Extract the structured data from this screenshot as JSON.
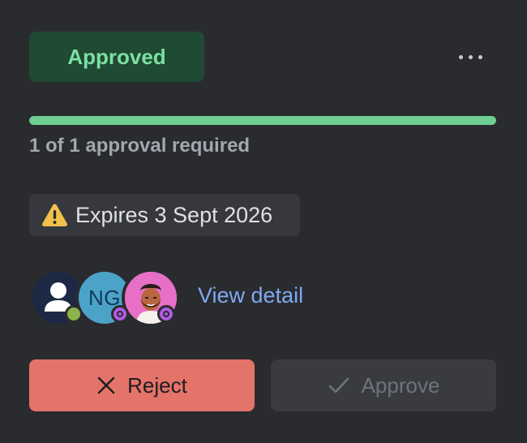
{
  "status": {
    "label": "Approved",
    "color": "#7ce0a0",
    "background": "#1f4a33"
  },
  "menu": {
    "icon": "more-horizontal-icon"
  },
  "progress": {
    "current": 1,
    "required": 1,
    "fraction": 1.0,
    "label": "1 of 1 approval required",
    "color": "#6fcf93"
  },
  "expiry": {
    "icon": "warning-icon",
    "text": "Expires 3 Sept 2026"
  },
  "approvers": [
    {
      "kind": "default-user-avatar",
      "status": "online"
    },
    {
      "initials": "NG",
      "status": "ring"
    },
    {
      "kind": "photo-avatar",
      "status": "ring"
    }
  ],
  "view_detail": {
    "label": "View detail",
    "color": "#7fa9f0"
  },
  "actions": {
    "reject": {
      "label": "Reject",
      "icon": "close-icon",
      "color": "#e4736a"
    },
    "approve": {
      "label": "Approve",
      "icon": "check-icon",
      "disabled": true
    }
  }
}
